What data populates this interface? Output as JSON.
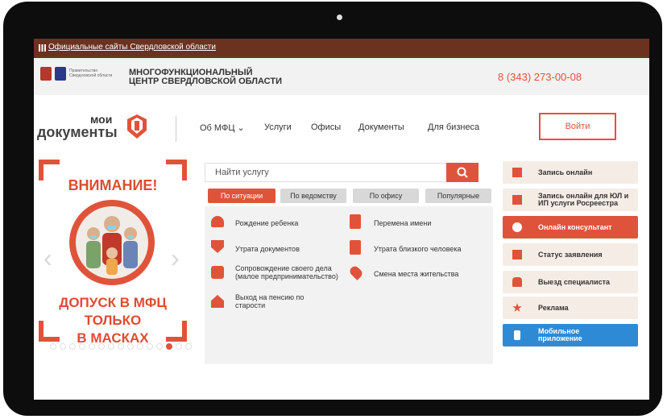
{
  "topbar": {
    "link": "Официальные сайты Свердловской области"
  },
  "header": {
    "gov_label": "Правительство Свердловской области",
    "title_line1": "МНОГОФУНКЦИОНАЛЬНЫЙ",
    "title_line2": "ЦЕНТР СВЕРДЛОВСКОЙ ОБЛАСТИ",
    "phone": "8 (343) 273-00-08"
  },
  "logo": {
    "line1": "мои",
    "line2": "документы"
  },
  "nav": {
    "items": [
      "Об МФЦ",
      "Услуги",
      "Офисы",
      "Документы",
      "Для бизнеса"
    ],
    "login": "Войти"
  },
  "banner": {
    "title": "ВНИМАНИЕ!",
    "line1": "ДОПУСК В МФЦ",
    "line2": "ТОЛЬКО",
    "line3": "В МАСКАХ"
  },
  "search": {
    "placeholder": "Найти услугу"
  },
  "tabs": [
    "По ситуации",
    "По ведомству",
    "По офису",
    "Популярные"
  ],
  "situations": {
    "left": [
      "Рождение ребенка",
      "Утрата документов",
      "Сопровождение своего дела (малое предпринимательство)",
      "Выход на пенсию по старости"
    ],
    "right": [
      "Перемена имени",
      "Утрата близкого человека",
      "Смена места жительства"
    ]
  },
  "sidebar": [
    "Запись онлайн",
    "Запись онлайн для ЮЛ и ИП услуги Росреестра",
    "Онлайн консультант",
    "Статус заявления",
    "Выезд специалиста",
    "Реклама",
    "Мобильное приложение"
  ],
  "colors": {
    "accent": "#e0533b",
    "topbar": "#6b3220",
    "mobile": "#2f8ad6"
  }
}
